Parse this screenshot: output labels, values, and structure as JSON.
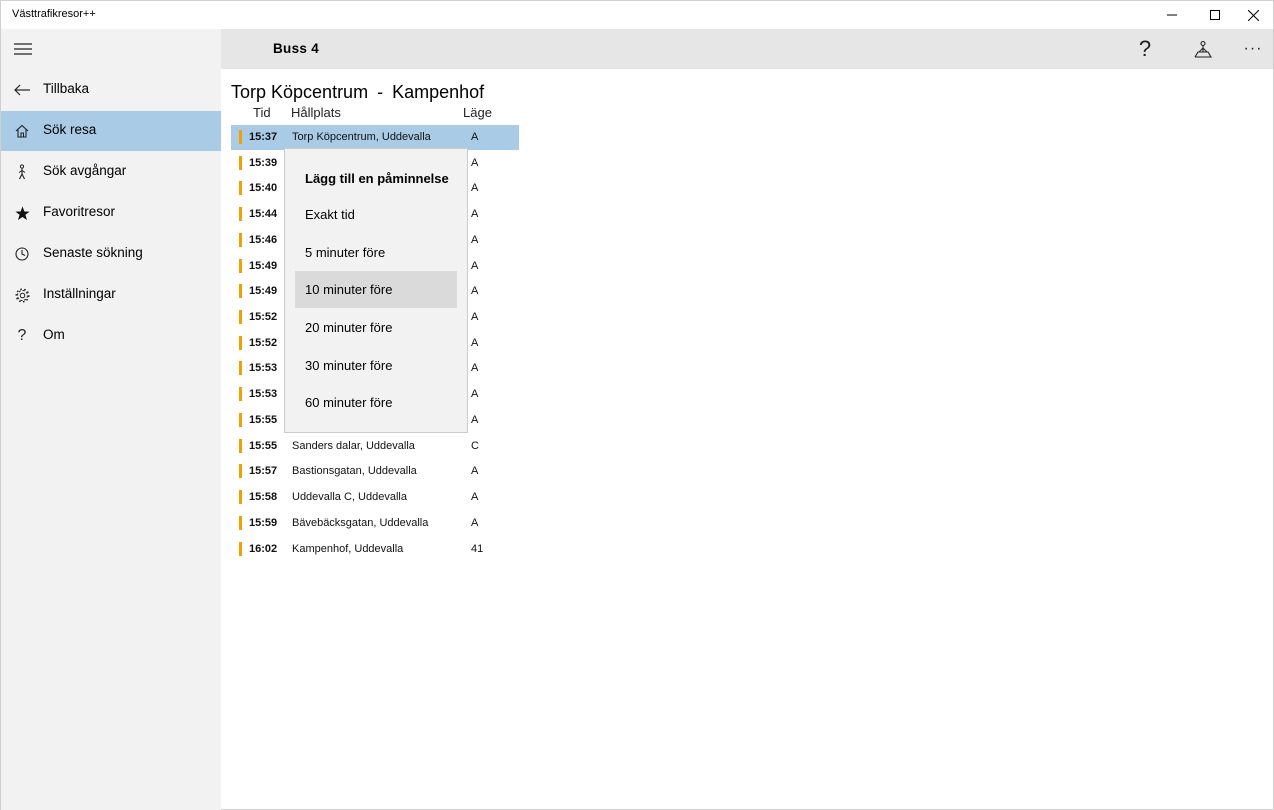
{
  "window": {
    "title": "Västtrafikresor++"
  },
  "sidebar": {
    "items": [
      {
        "label": "Tillbaka",
        "icon": "back-arrow-icon"
      },
      {
        "label": "Sök resa",
        "icon": "home-icon",
        "active": true
      },
      {
        "label": "Sök avgångar",
        "icon": "person-walking-icon"
      },
      {
        "label": "Favoritresor",
        "icon": "star-icon"
      },
      {
        "label": "Senaste sökning",
        "icon": "clock-icon"
      },
      {
        "label": "Inställningar",
        "icon": "gear-icon"
      },
      {
        "label": "Om",
        "icon": "question-icon"
      }
    ]
  },
  "header": {
    "title": "Buss 4",
    "help_glyph": "?",
    "more_glyph": "···"
  },
  "route": {
    "from": "Torp Köpcentrum",
    "separator": "-",
    "to": "Kampenhof"
  },
  "table": {
    "headers": {
      "time": "Tid",
      "stop": "Hållplats",
      "position": "Läge"
    },
    "line_color": "#f0a000",
    "rows": [
      {
        "time": "15:37",
        "stop": "Torp Köpcentrum, Uddevalla",
        "position": "A"
      },
      {
        "time": "15:39",
        "stop": "",
        "position": "A"
      },
      {
        "time": "15:40",
        "stop": "",
        "position": "A"
      },
      {
        "time": "15:44",
        "stop": "",
        "position": "A"
      },
      {
        "time": "15:46",
        "stop": "",
        "position": "A"
      },
      {
        "time": "15:49",
        "stop": "",
        "position": "A"
      },
      {
        "time": "15:49",
        "stop": "",
        "position": "A"
      },
      {
        "time": "15:52",
        "stop": "",
        "position": "A"
      },
      {
        "time": "15:52",
        "stop": "",
        "position": "A"
      },
      {
        "time": "15:53",
        "stop": "",
        "position": "A"
      },
      {
        "time": "15:53",
        "stop": "",
        "position": "A"
      },
      {
        "time": "15:55",
        "stop": "",
        "position": "A"
      },
      {
        "time": "15:55",
        "stop": "Sanders dalar, Uddevalla",
        "position": "C"
      },
      {
        "time": "15:57",
        "stop": "Bastionsgatan, Uddevalla",
        "position": "A"
      },
      {
        "time": "15:58",
        "stop": "Uddevalla C, Uddevalla",
        "position": "A"
      },
      {
        "time": "15:59",
        "stop": "Bävebäcksgatan, Uddevalla",
        "position": "A"
      },
      {
        "time": "16:02",
        "stop": "Kampenhof, Uddevalla",
        "position": "41"
      }
    ]
  },
  "flyout": {
    "title": "Lägg till en påminnelse",
    "options": [
      "Exakt tid",
      "5 minuter före",
      "10 minuter före",
      "20 minuter före",
      "30 minuter före",
      "60 minuter före"
    ],
    "highlighted": "10 minuter före"
  },
  "colors": {
    "selected": "#a9cbe6",
    "sidebar_bg": "#f2f2f2",
    "header_bg": "#e6e6e6",
    "line_marker": "#f0a000"
  }
}
